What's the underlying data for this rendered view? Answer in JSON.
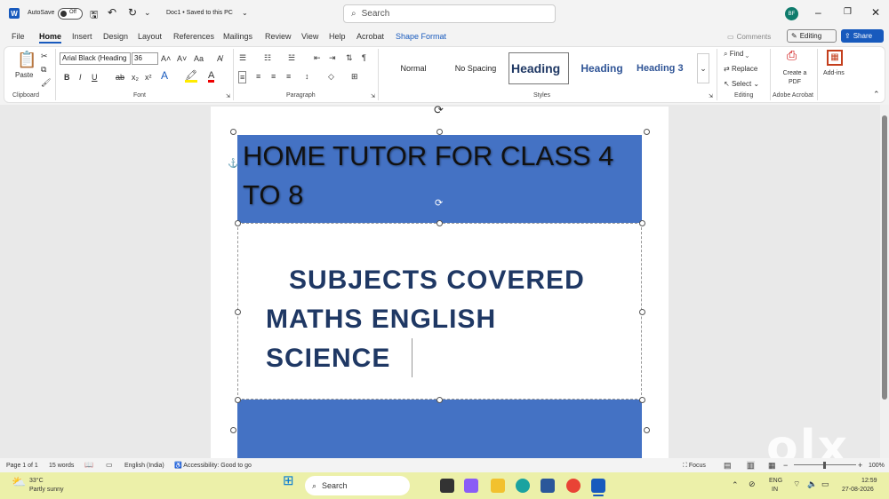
{
  "titlebar": {
    "autosave_label": "AutoSave",
    "autosave_state": "Off",
    "doc_title": "Doc1 • Saved to this PC",
    "search_placeholder": "Search",
    "avatar_initials": "BF"
  },
  "menu": {
    "tabs": [
      "File",
      "Home",
      "Insert",
      "Design",
      "Layout",
      "References",
      "Mailings",
      "Review",
      "View",
      "Help",
      "Acrobat",
      "Shape Format"
    ],
    "comments": "Comments",
    "editing": "Editing",
    "share": "Share"
  },
  "ribbon": {
    "paste": "Paste",
    "clipboard": "Clipboard",
    "font_name": "Arial Black (Heading",
    "font_size": "36",
    "font": "Font",
    "paragraph": "Paragraph",
    "styles": [
      "Normal",
      "No Spacing",
      "Heading",
      "Heading",
      "Heading 3"
    ],
    "styles_label": "Styles",
    "find": "Find",
    "replace": "Replace",
    "select": "Select",
    "editing_label": "Editing",
    "create_pdf": "Create a PDF",
    "adobe": "Adobe Acrobat",
    "addins": "Add-ins"
  },
  "document": {
    "heading": "HOME TUTOR FOR CLASS 4 TO 8",
    "subjects_line1": "SUBJECTS COVERED",
    "subjects_line2": "MATHS ENGLISH",
    "subjects_line3": "SCIENCE"
  },
  "statusbar": {
    "page": "Page 1 of 1",
    "words": "15 words",
    "language": "English (India)",
    "accessibility": "Accessibility: Good to go",
    "focus": "Focus",
    "zoom": "100%"
  },
  "taskbar": {
    "temp": "33°C",
    "weather": "Partly sunny",
    "search": "Search",
    "lang1": "ENG",
    "lang2": "IN",
    "time": "12:59",
    "date": "27-08-2026"
  },
  "watermark": "olx",
  "colors": {
    "accent": "#185abd",
    "band": "#4472c4",
    "subject_text": "#1f3864"
  }
}
